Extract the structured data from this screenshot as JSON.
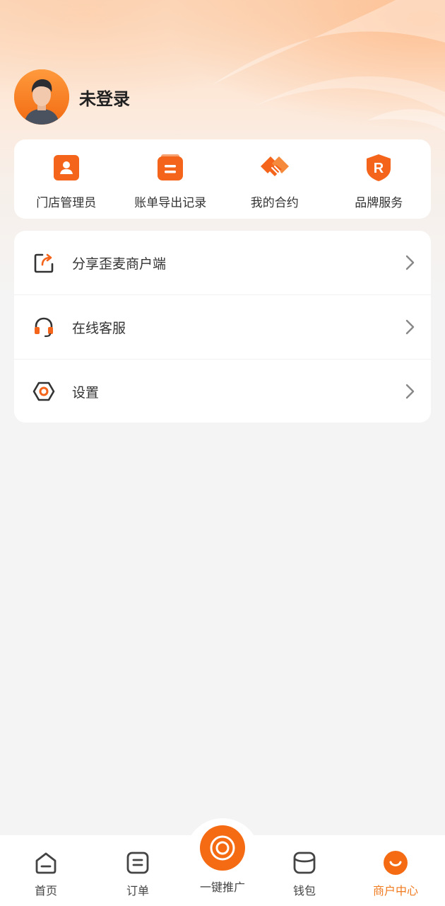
{
  "profile": {
    "name": "未登录"
  },
  "quick_actions": [
    {
      "label": "门店管理员",
      "icon": "store-admin-icon"
    },
    {
      "label": "账单导出记录",
      "icon": "bill-export-icon"
    },
    {
      "label": "我的合约",
      "icon": "handshake-icon"
    },
    {
      "label": "品牌服务",
      "icon": "brand-shield-icon"
    }
  ],
  "menu": [
    {
      "label": "分享歪麦商户端",
      "icon": "share-icon"
    },
    {
      "label": "在线客服",
      "icon": "headset-icon"
    },
    {
      "label": "设置",
      "icon": "settings-hexagon-icon"
    }
  ],
  "tabs": [
    {
      "label": "首页",
      "icon": "home-icon",
      "active": false
    },
    {
      "label": "订单",
      "icon": "order-icon",
      "active": false
    },
    {
      "label": "一键推广",
      "icon": "promote-target-icon",
      "active": false
    },
    {
      "label": "钱包",
      "icon": "wallet-icon",
      "active": false
    },
    {
      "label": "商户中心",
      "icon": "merchant-smile-icon",
      "active": true
    }
  ],
  "colors": {
    "accent": "#f56b14",
    "active_tab": "#f07a1e",
    "background": "#f4f4f4"
  }
}
